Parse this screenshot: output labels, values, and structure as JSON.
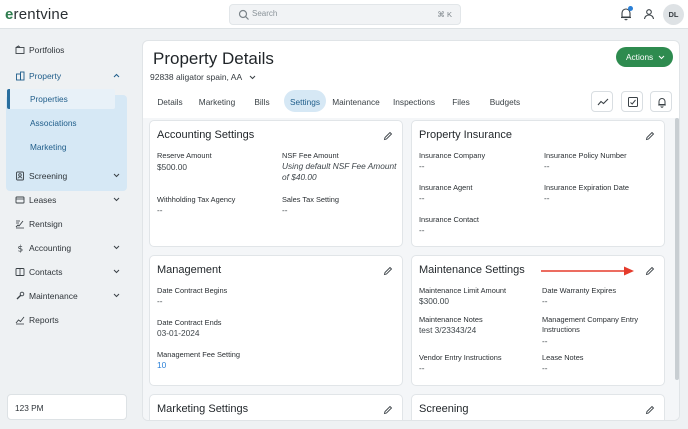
{
  "brand": {
    "logo_mark": "e",
    "logo_text": "rentvine"
  },
  "search": {
    "placeholder": "Search",
    "shortcut": "⌘ K"
  },
  "user": {
    "initials": "DL"
  },
  "sidebar": {
    "items": [
      {
        "label": "Portfolios",
        "icon": "portfolios-icon"
      },
      {
        "label": "Property",
        "icon": "property-icon",
        "expanded": true
      },
      {
        "label": "Screening",
        "icon": "screening-icon"
      },
      {
        "label": "Leases",
        "icon": "leases-icon"
      },
      {
        "label": "Rentsign",
        "icon": "rentsign-icon"
      },
      {
        "label": "Accounting",
        "icon": "accounting-icon"
      },
      {
        "label": "Contacts",
        "icon": "contacts-icon"
      },
      {
        "label": "Maintenance",
        "icon": "maintenance-icon"
      },
      {
        "label": "Reports",
        "icon": "reports-icon"
      }
    ],
    "property_subitems": [
      {
        "label": "Properties",
        "active": true
      },
      {
        "label": "Associations"
      },
      {
        "label": "Marketing"
      }
    ],
    "bottom_text": "123 PM"
  },
  "page": {
    "title": "Property Details",
    "address": "92838 aligator spain, AA",
    "actions_label": "Actions",
    "tabs": [
      "Details",
      "Marketing",
      "Bills",
      "Settings",
      "Maintenance",
      "Inspections",
      "Files",
      "Budgets"
    ],
    "active_tab": "Settings"
  },
  "cards": {
    "accounting": {
      "title": "Accounting Settings",
      "reserve_amount_label": "Reserve Amount",
      "reserve_amount_value": "$500.00",
      "nsf_fee_label": "NSF Fee Amount",
      "nsf_fee_value": "Using default NSF Fee Amount of $40.00",
      "withholding_label": "Withholding Tax Agency",
      "withholding_value": "--",
      "sales_tax_label": "Sales Tax Setting",
      "sales_tax_value": "--"
    },
    "insurance": {
      "title": "Property Insurance",
      "company_label": "Insurance Company",
      "company_value": "--",
      "policy_label": "Insurance Policy Number",
      "policy_value": "--",
      "agent_label": "Insurance Agent",
      "agent_value": "--",
      "expiration_label": "Insurance Expiration Date",
      "expiration_value": "--",
      "contact_label": "Insurance Contact",
      "contact_value": "--"
    },
    "management": {
      "title": "Management",
      "begins_label": "Date Contract Begins",
      "begins_value": "--",
      "ends_label": "Date Contract Ends",
      "ends_value": "03-01-2024",
      "fee_label": "Management Fee Setting",
      "fee_value": "10"
    },
    "maintenance": {
      "title": "Maintenance Settings",
      "limit_label": "Maintenance Limit Amount",
      "limit_value": "$300.00",
      "warranty_label": "Date Warranty Expires",
      "warranty_value": "--",
      "notes_label": "Maintenance Notes",
      "notes_value": "test 3/23343/24",
      "mgmt_entry_label": "Management Company Entry Instructions",
      "mgmt_entry_value": "--",
      "vendor_label": "Vendor Entry Instructions",
      "vendor_value": "--",
      "lease_notes_label": "Lease Notes",
      "lease_notes_value": "--"
    },
    "marketing": {
      "title": "Marketing Settings"
    },
    "screening": {
      "title": "Screening"
    }
  },
  "colors": {
    "accent_green": "#2e8b4f",
    "nav_active_bg": "#d6e8f5",
    "annotation_arrow": "#e53b2c"
  }
}
